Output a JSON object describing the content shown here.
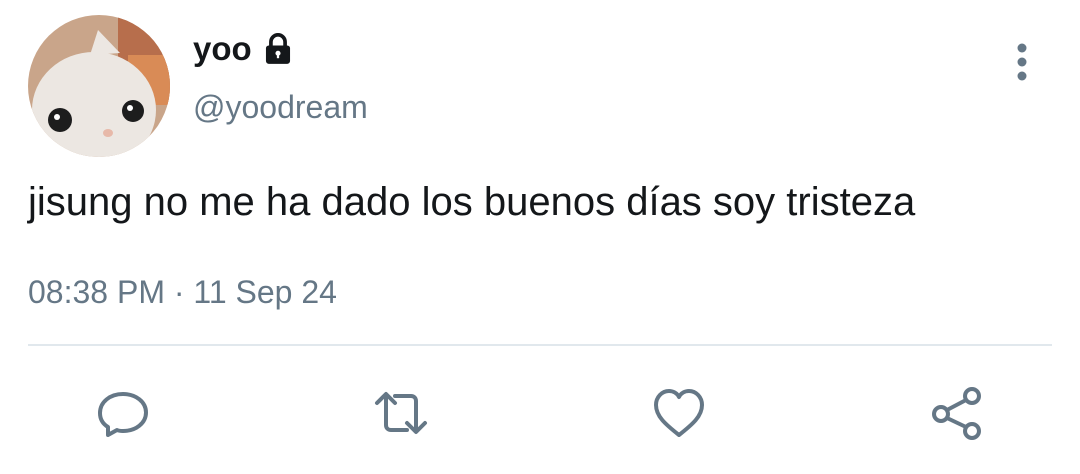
{
  "tweet": {
    "author": {
      "display_name": "yoo",
      "handle": "@yoodream",
      "protected_icon": "lock-icon",
      "avatar_icon": "plush-cat-avatar"
    },
    "text": "jisung no me ha dado los buenos días soy tristeza",
    "timestamp": "08:38 PM · 11 Sep 24"
  },
  "menu": {
    "icon": "more-vertical-icon"
  },
  "actions": [
    {
      "name": "reply",
      "icon": "reply-icon"
    },
    {
      "name": "retweet",
      "icon": "retweet-icon"
    },
    {
      "name": "like",
      "icon": "heart-icon"
    },
    {
      "name": "share",
      "icon": "share-icon"
    }
  ],
  "colors": {
    "text_primary": "#14171a",
    "text_secondary": "#657786",
    "divider": "#e1e8ed",
    "icon": "#657786"
  }
}
